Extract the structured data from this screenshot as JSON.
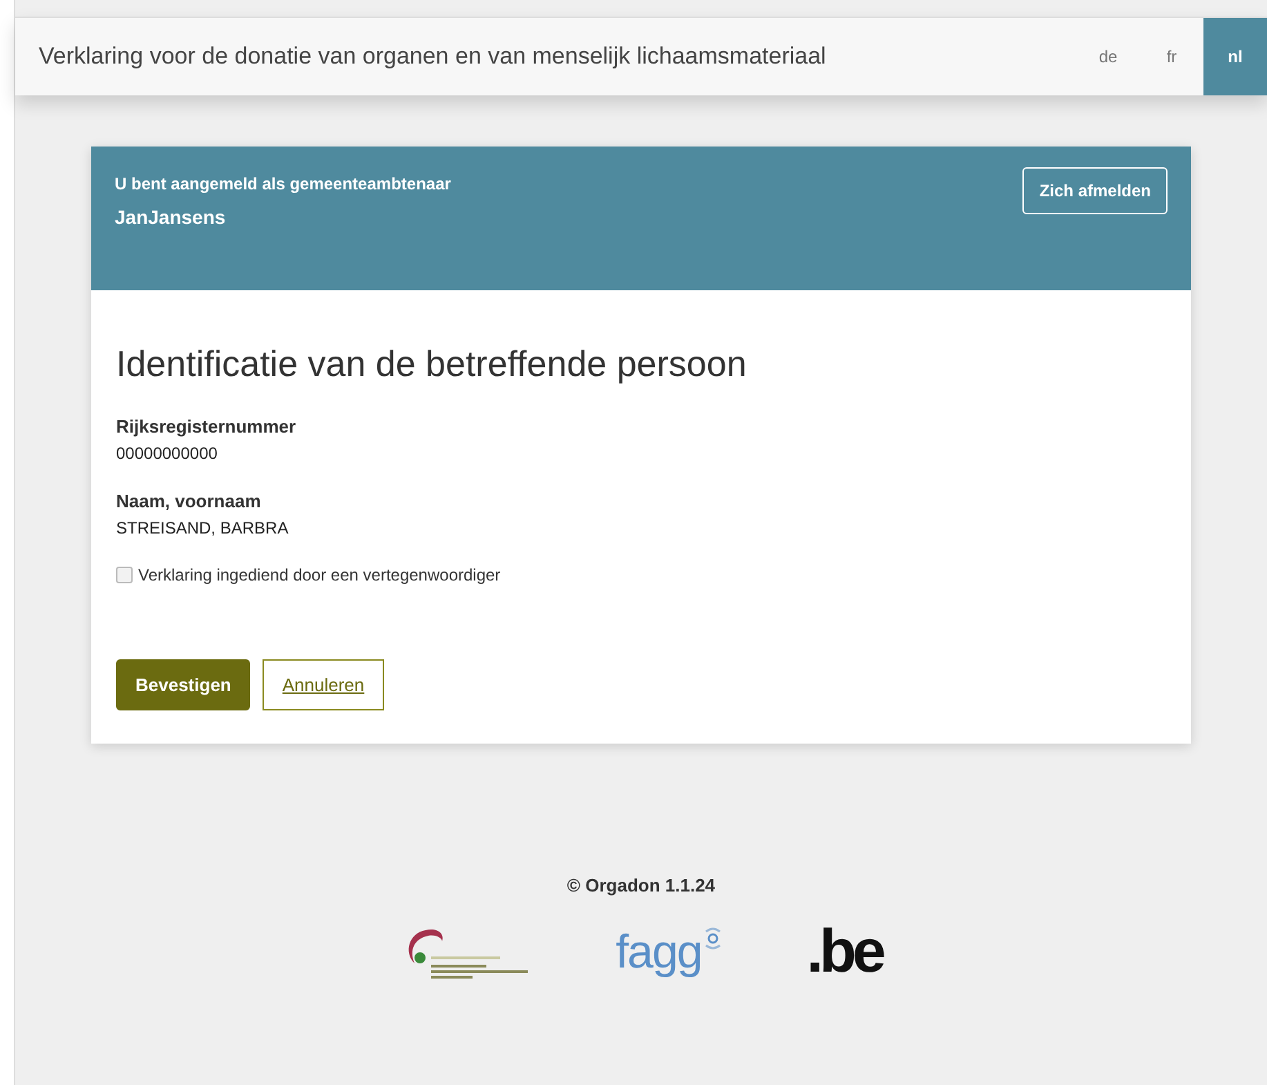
{
  "header": {
    "title": "Verklaring voor de donatie van organen en van menselijk lichaamsmateriaal",
    "languages": [
      {
        "label": "de",
        "selected": false
      },
      {
        "label": "fr",
        "selected": false
      },
      {
        "label": "nl",
        "selected": true
      }
    ]
  },
  "session": {
    "role_text": "U bent aangemeld als gemeenteambtenaar",
    "user": "JanJansens",
    "logout_button": "Zich afmelden"
  },
  "form": {
    "title": "Identificatie van de betreffende persoon",
    "fields": [
      {
        "label": "Rijksregisternummer",
        "value": "00000000000"
      },
      {
        "label": "Naam, voornaam",
        "value": "STREISAND, BARBRA"
      }
    ],
    "checkbox": {
      "label": "Verklaring ingediend door een vertegenwoordiger",
      "checked": false
    },
    "buttons": [
      {
        "label": "Bevestigen",
        "kind": "primary"
      },
      {
        "label": "Annuleren",
        "kind": "secondary"
      }
    ]
  },
  "footer": {
    "copyright": "© Orgadon 1.1.24",
    "logos": [
      {
        "kind": "emblem"
      },
      {
        "kind": "fagg",
        "text": "fagg"
      },
      {
        "kind": "be",
        "text": ".be"
      }
    ]
  }
}
